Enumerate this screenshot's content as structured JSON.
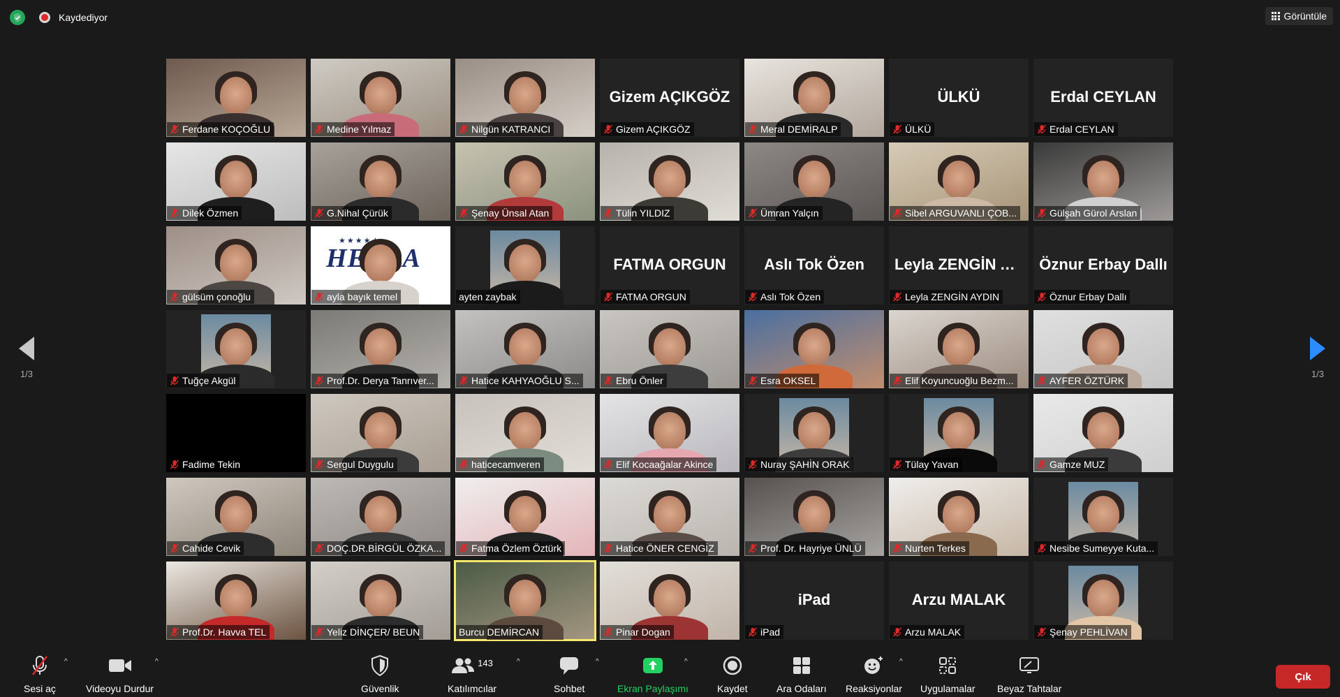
{
  "topbar": {
    "recording_label": "Kaydediyor",
    "view_label": "Görüntüle"
  },
  "paging": {
    "prev_label": "1/3",
    "next_label": "1/3"
  },
  "participants": [
    {
      "name": "Ferdane KOÇOĞLU",
      "muted": true,
      "video": true,
      "c1": "#6e5a4e",
      "c2": "#b9a898",
      "shirt": "#3a2f2f"
    },
    {
      "name": "Medine Yılmaz",
      "muted": true,
      "video": true,
      "c1": "#cfcbc4",
      "c2": "#9b8f80",
      "shirt": "#c96c7a"
    },
    {
      "name": "Nilgün KATRANCI",
      "muted": true,
      "video": true,
      "c1": "#9a8e85",
      "c2": "#d6cfc8",
      "shirt": "#4a4240"
    },
    {
      "name": "Gizem AÇIKGÖZ",
      "muted": true,
      "video": false,
      "banner": "Gizem AÇIKGÖZ"
    },
    {
      "name": "Meral DEMİRALP",
      "muted": true,
      "video": true,
      "c1": "#e8e4de",
      "c2": "#b2a79d",
      "shirt": "#2a2a2a"
    },
    {
      "name": "ÜLKÜ",
      "muted": true,
      "video": false,
      "banner": "ÜLKÜ"
    },
    {
      "name": "Erdal CEYLAN",
      "muted": true,
      "video": false,
      "banner": "Erdal CEYLAN"
    },
    {
      "name": "Dilek Özmen",
      "muted": true,
      "video": true,
      "c1": "#e6e6e6",
      "c2": "#bdbdbd",
      "shirt": "#1e1e1e"
    },
    {
      "name": "G.Nihal Çürük",
      "muted": true,
      "video": true,
      "c1": "#a8a29b",
      "c2": "#6c635b",
      "shirt": "#2b2b2b"
    },
    {
      "name": "Şenay Ünsal Atan",
      "muted": true,
      "video": true,
      "c1": "#c7c2b0",
      "c2": "#8b927f",
      "shirt": "#b33a3a"
    },
    {
      "name": "Tülin YILDIZ",
      "muted": true,
      "video": true,
      "c1": "#b7b2ac",
      "c2": "#e0dcd6",
      "shirt": "#3c3b35"
    },
    {
      "name": "Ümran Yalçın",
      "muted": true,
      "video": true,
      "c1": "#8d8884",
      "c2": "#5b5755",
      "shirt": "#242424"
    },
    {
      "name": "Sibel ARGUVANLI ÇOB...",
      "muted": true,
      "video": true,
      "c1": "#d7cbb6",
      "c2": "#a59377",
      "shirt": "#ccb8a4"
    },
    {
      "name": "Gülşah Gürol Arslan",
      "muted": true,
      "video": true,
      "c1": "#3a3a3a",
      "c2": "#9d9a98",
      "shirt": "#d0d0d0"
    },
    {
      "name": "gülsüm çonoğlu",
      "muted": true,
      "video": true,
      "c1": "#9d8f86",
      "c2": "#cfc8c3",
      "shirt": "#4d4744"
    },
    {
      "name": "ayla bayık temel",
      "muted": true,
      "video": true,
      "logo": true,
      "c1": "#ffffff",
      "c2": "#ffffff",
      "shirt": "#d8d2cd"
    },
    {
      "name": "ayten zaybak",
      "muted": false,
      "video": true,
      "inset": true,
      "c1": "#232323",
      "c2": "#232323",
      "shirt": "#1b1b1b"
    },
    {
      "name": "FATMA ORGUN",
      "muted": true,
      "video": false,
      "banner": "FATMA ORGUN"
    },
    {
      "name": "Aslı Tok Özen",
      "muted": true,
      "video": false,
      "banner": "Aslı Tok Özen"
    },
    {
      "name": "Leyla ZENGİN AYDIN",
      "muted": true,
      "video": false,
      "banner": "Leyla ZENGİN A..."
    },
    {
      "name": "Öznur Erbay Dallı",
      "muted": true,
      "video": false,
      "banner": "Öznur Erbay Dallı"
    },
    {
      "name": "Tuğçe Akgül",
      "muted": true,
      "video": true,
      "inset": true,
      "c1": "#232323",
      "c2": "#232323",
      "shirt": "#2b2b2b"
    },
    {
      "name": "Prof.Dr. Derya Tanrıver...",
      "muted": true,
      "video": true,
      "c1": "#7c7a76",
      "c2": "#b4b1ac",
      "shirt": "#2a2a2a"
    },
    {
      "name": "Hatice KAHYAOĞLU S...",
      "muted": true,
      "video": true,
      "c1": "#c4c2c0",
      "c2": "#8c8a88",
      "shirt": "#3a3a3a"
    },
    {
      "name": "Ebru Önler",
      "muted": true,
      "video": true,
      "c1": "#c9c6c2",
      "c2": "#9c9893",
      "shirt": "#3d3d3d"
    },
    {
      "name": "Esra OKSEL",
      "muted": true,
      "video": true,
      "c1": "#4a6fa0",
      "c2": "#c18e6e",
      "shirt": "#d06a3b"
    },
    {
      "name": "Elif Koyuncuoğlu Bezm...",
      "muted": true,
      "video": true,
      "c1": "#dad5cf",
      "c2": "#9d8c80",
      "shirt": "#6a5c52"
    },
    {
      "name": "AYFER ÖZTÜRK",
      "muted": true,
      "video": true,
      "c1": "#e0e0e0",
      "c2": "#c4c4c4",
      "shirt": "#b9a89b"
    },
    {
      "name": "Fadime Tekin",
      "muted": true,
      "video": false,
      "black": true
    },
    {
      "name": "Sergul Duygulu",
      "muted": true,
      "video": true,
      "c1": "#cfc8c0",
      "c2": "#a89e92",
      "shirt": "#3b3b3b"
    },
    {
      "name": "haticecamveren",
      "muted": true,
      "video": true,
      "c1": "#c7c2bc",
      "c2": "#e2ddd7",
      "shirt": "#7b8b80"
    },
    {
      "name": "Elif Kocaağalar Akince",
      "muted": true,
      "video": true,
      "c1": "#e4e4e6",
      "c2": "#b8b6bb",
      "shirt": "#e6a7b0"
    },
    {
      "name": "Nuray ŞAHİN ORAK",
      "muted": true,
      "video": true,
      "inset": true,
      "c1": "#232323",
      "c2": "#232323",
      "shirt": "#3c3c3c"
    },
    {
      "name": "Tülay Yavan",
      "muted": true,
      "video": true,
      "inset": true,
      "c1": "#232323",
      "c2": "#232323",
      "shirt": "#0a0a0a"
    },
    {
      "name": "Gamze MUZ",
      "muted": true,
      "video": true,
      "c1": "#e9e9e9",
      "c2": "#cfcfcf",
      "shirt": "#3b3b3b"
    },
    {
      "name": "Cahide Cevik",
      "muted": true,
      "video": true,
      "c1": "#d0c8bf",
      "c2": "#8e8579",
      "shirt": "#2d2d2d"
    },
    {
      "name": "DOÇ.DR.BİRGÜL ÖZKA...",
      "muted": true,
      "video": true,
      "c1": "#bdb9b6",
      "c2": "#8e8984",
      "shirt": "#3a3a3a"
    },
    {
      "name": "Fatma Özlem Öztürk",
      "muted": true,
      "video": true,
      "c1": "#f0eeed",
      "c2": "#e3b5b9",
      "shirt": "#222222"
    },
    {
      "name": "Hatice ÖNER CENGİZ",
      "muted": true,
      "video": true,
      "c1": "#dcdad6",
      "c2": "#b9b4ae",
      "shirt": "#5a4f48"
    },
    {
      "name": "Prof. Dr. Hayriye ÜNLÜ",
      "muted": true,
      "video": true,
      "c1": "#575250",
      "c2": "#a6a3a0",
      "shirt": "#1f1f1f"
    },
    {
      "name": "Nurten Terkes",
      "muted": true,
      "video": true,
      "c1": "#efeeec",
      "c2": "#c7b7a5",
      "shirt": "#8a6a4e"
    },
    {
      "name": "Nesibe Sumeyye Kuta...",
      "muted": true,
      "video": true,
      "inset": true,
      "c1": "#232323",
      "c2": "#232323",
      "shirt": "#2b2b2b"
    },
    {
      "name": "Prof.Dr. Havva TEL",
      "muted": true,
      "video": true,
      "c1": "#ece8e2",
      "c2": "#6b5340",
      "shirt": "#c52a2a"
    },
    {
      "name": "Yeliz DİNÇER/ BEUN",
      "muted": true,
      "video": true,
      "c1": "#d3cfc9",
      "c2": "#a29c95",
      "shirt": "#2c2c2c"
    },
    {
      "name": "Burcu DEMİRCAN",
      "muted": false,
      "video": true,
      "active": true,
      "c1": "#4b5a45",
      "c2": "#a39681",
      "shirt": "#5c4a3f"
    },
    {
      "name": "Pinar Dogan",
      "muted": true,
      "video": true,
      "c1": "#e2dfda",
      "c2": "#c1b4a8",
      "shirt": "#9c3434"
    },
    {
      "name": "iPad",
      "muted": true,
      "video": false,
      "banner": "iPad"
    },
    {
      "name": "Arzu MALAK",
      "muted": true,
      "video": false,
      "banner": "Arzu MALAK"
    },
    {
      "name": "Şenay PEHLİVAN",
      "muted": true,
      "video": true,
      "inset": true,
      "c1": "#232323",
      "c2": "#232323",
      "shirt": "#e2c6a6"
    }
  ],
  "toolbar": {
    "unmute_label": "Sesi aç",
    "stop_video_label": "Videoyu Durdur",
    "security_label": "Güvenlik",
    "participants_label": "Katılımcılar",
    "participants_count": "143",
    "chat_label": "Sohbet",
    "share_label": "Ekran Paylaşımı",
    "record_label": "Kaydet",
    "breakout_label": "Ara Odaları",
    "reactions_label": "Reaksiyonlar",
    "apps_label": "Uygulamalar",
    "whiteboard_label": "Beyaz Tahtalar",
    "leave_label": "Çık"
  },
  "colors": {
    "background": "#1a1a1a",
    "accent_blue": "#2d8cff",
    "share_green": "#23d160",
    "leave_red": "#c62828",
    "muted_red": "#e02828",
    "active_speaker": "#f5e86b"
  }
}
